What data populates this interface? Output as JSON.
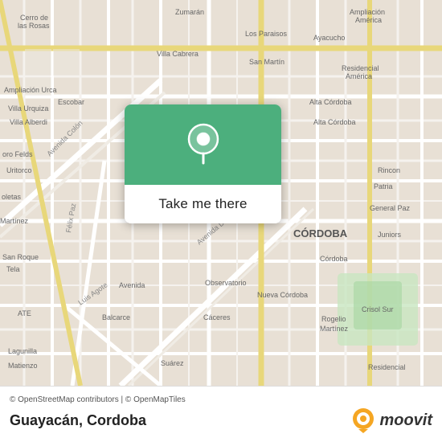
{
  "map": {
    "attribution": "© OpenStreetMap contributors | © OpenMapTiles",
    "center_lat": -31.41,
    "center_lng": -64.19
  },
  "popup": {
    "button_label": "Take me there"
  },
  "bottom_bar": {
    "location_name": "Guayacán, Cordoba",
    "moovit_label": "moovit"
  }
}
